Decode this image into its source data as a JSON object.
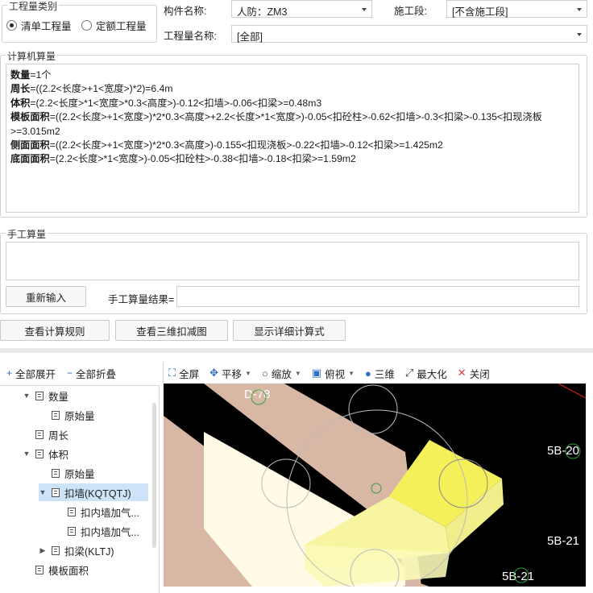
{
  "quantity_type": {
    "title": "工程量类别",
    "options": [
      {
        "label": "清单工程量",
        "selected": true
      },
      {
        "label": "定额工程量",
        "selected": false
      }
    ]
  },
  "filters": {
    "component_label": "构件名称:",
    "component_value": "人防：ZM3",
    "stage_label": "施工段:",
    "stage_value": "[不含施工段]",
    "quantity_name_label": "工程量名称:",
    "quantity_name_value": "[全部]"
  },
  "computer_calc": {
    "title": "计算机算量",
    "lines": [
      {
        "name": "数量",
        "formula": "=1个"
      },
      {
        "name": "周长",
        "formula": "=((2.2<长度>+1<宽度>)*2)=6.4m"
      },
      {
        "name": "体积",
        "formula": "=(2.2<长度>*1<宽度>*0.3<高度>)-0.12<扣墙>-0.06<扣梁>=0.48m3"
      },
      {
        "name": "模板面积",
        "formula": "=((2.2<长度>+1<宽度>)*2*0.3<高度>+2.2<长度>*1<宽度>)-0.05<扣砼柱>-0.62<扣墙>-0.3<扣梁>-0.135<扣现浇板>=3.015m2"
      },
      {
        "name": "侧面面积",
        "formula": "=((2.2<长度>+1<宽度>)*2*0.3<高度>)-0.155<扣现浇板>-0.22<扣墙>-0.12<扣梁>=1.425m2"
      },
      {
        "name": "底面面积",
        "formula": "=(2.2<长度>*1<宽度>)-0.05<扣砼柱>-0.38<扣墙>-0.18<扣梁>=1.59m2"
      }
    ]
  },
  "manual_calc": {
    "title": "手工算量",
    "reenter_label": "重新输入",
    "result_label": "手工算量结果=",
    "result_value": ""
  },
  "actions": {
    "view_rules": "查看计算规则",
    "view_3d": "查看三维扣减图",
    "show_detail": "显示详细计算式"
  },
  "tree_toolbar": {
    "expand_all": "全部展开",
    "collapse_all": "全部折叠"
  },
  "tree": [
    {
      "label": "数量",
      "level": 1,
      "toggle": "down"
    },
    {
      "label": "原始量",
      "level": 2,
      "toggle": ""
    },
    {
      "label": "周长",
      "level": 1,
      "toggle": ""
    },
    {
      "label": "体积",
      "level": 1,
      "toggle": "down"
    },
    {
      "label": "原始量",
      "level": 2,
      "toggle": ""
    },
    {
      "label": "扣墙(KQTQTJ)",
      "level": 2,
      "toggle": "down",
      "selected": true
    },
    {
      "label": "扣内墙加气...",
      "level": 3,
      "toggle": ""
    },
    {
      "label": "扣内墙加气...",
      "level": 3,
      "toggle": ""
    },
    {
      "label": "扣梁(KLTJ)",
      "level": 2,
      "toggle": "right"
    },
    {
      "label": "模板面积",
      "level": 1,
      "toggle": ""
    }
  ],
  "view_toolbar": {
    "fullscreen": "全屏",
    "pan": "平移",
    "zoom": "缩放",
    "top_view": "俯视",
    "three_d": "三维",
    "maximize": "最大化",
    "close": "关闭"
  },
  "viewport_labels": {
    "d78": "D-78",
    "b20": "5B-20",
    "b21a": "5B-21",
    "b21b": "5B-21"
  },
  "colors": {
    "beam": "#d8b7a4",
    "slab": "#fffbe6",
    "column": "#f2f27a",
    "selection": "#cce3f8"
  }
}
